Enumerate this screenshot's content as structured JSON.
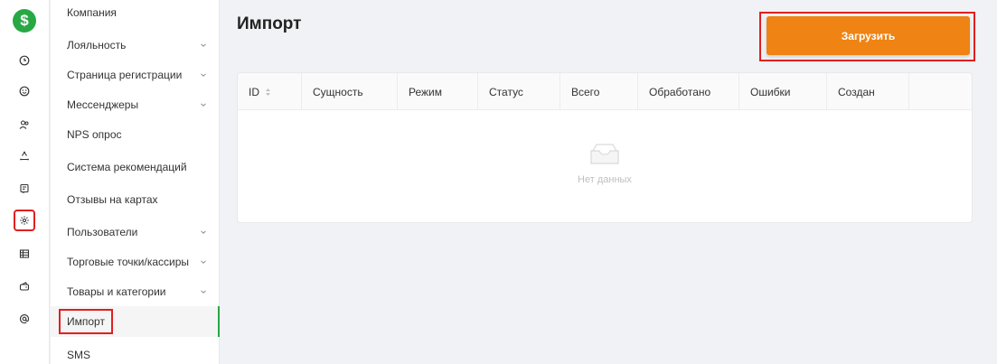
{
  "rail": {
    "logo": "$",
    "icons": [
      "clock-icon",
      "smile-icon",
      "users-icon",
      "recycle-icon",
      "receipt-icon",
      "gear-icon",
      "table-icon",
      "wallet-icon",
      "at-sign-icon"
    ]
  },
  "menu": {
    "items": [
      {
        "label": "Компания"
      },
      {
        "label": "Лояльность"
      },
      {
        "label": "Страница регистрации"
      },
      {
        "label": "Мессенджеры"
      },
      {
        "label": "NPS опрос"
      },
      {
        "label": "Система рекомендаций"
      },
      {
        "label": "Отзывы на картах"
      },
      {
        "label": "Пользователи"
      },
      {
        "label": "Торговые точки/кассиры"
      },
      {
        "label": "Товары и категории"
      },
      {
        "label": "Импорт"
      },
      {
        "label": "SMS"
      }
    ]
  },
  "main": {
    "title": "Импорт",
    "upload_label": "Загрузить",
    "table": {
      "columns": [
        "ID",
        "Сущность",
        "Режим",
        "Статус",
        "Всего",
        "Обработано",
        "Ошибки",
        "Создан"
      ],
      "empty_text": "Нет данных"
    }
  },
  "colors": {
    "brand_green": "#27a844",
    "accent_orange": "#ef8313",
    "highlight_red": "#e02020"
  }
}
